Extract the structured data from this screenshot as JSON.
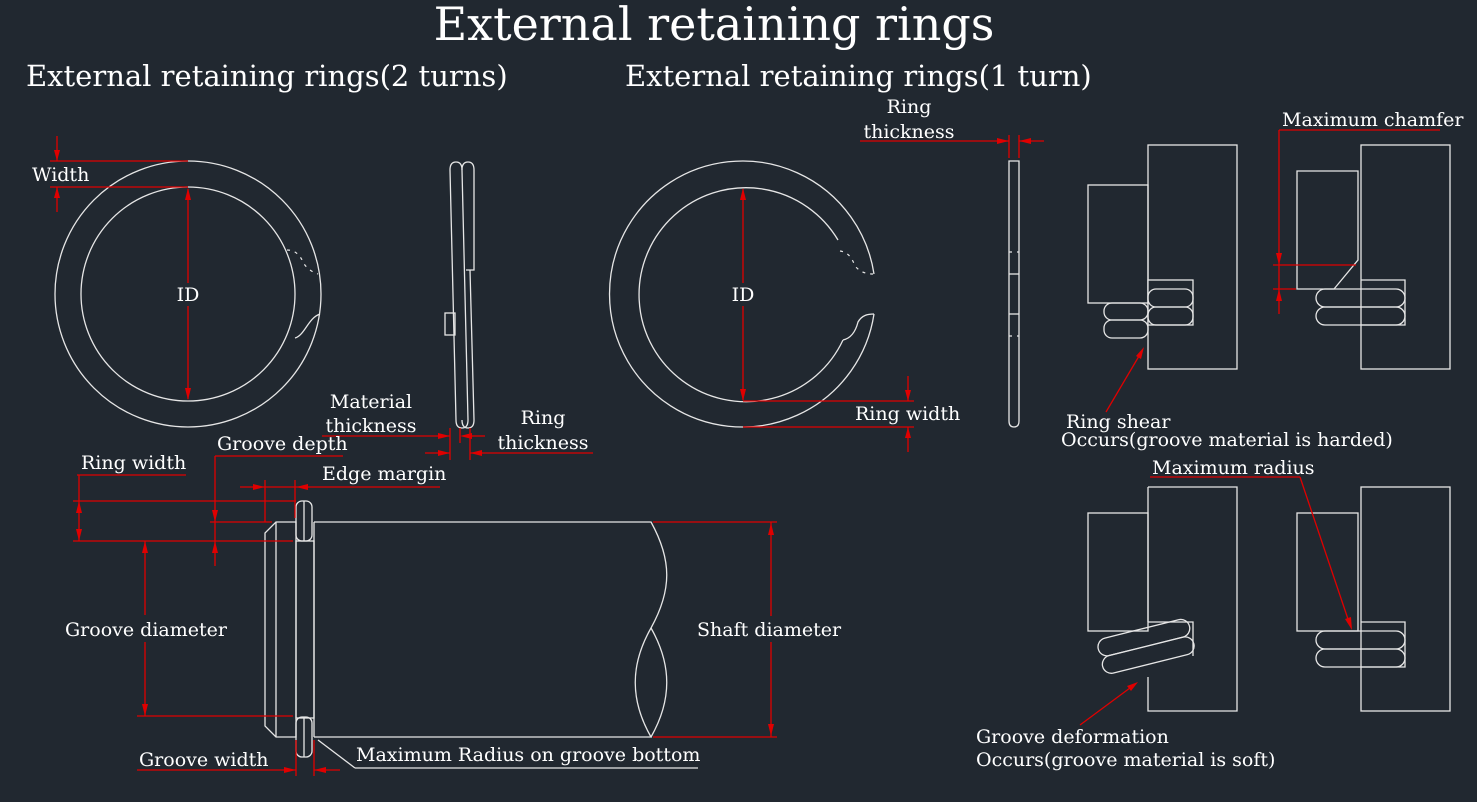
{
  "title": "External retaining rings",
  "sections": {
    "two_turns": "External retaining rings(2 turns)",
    "one_turn": "External retaining rings(1 turn)"
  },
  "labels": {
    "width": "Width",
    "id_2turn": "ID",
    "id_1turn": "ID",
    "material_thickness_1": "Material",
    "material_thickness_2": "thickness",
    "ring_thickness_2turn_1": "Ring",
    "ring_thickness_2turn_2": "thickness",
    "ring_thickness_1turn_1": "Ring",
    "ring_thickness_1turn_2": "thickness",
    "ring_width_1turn": "Ring width",
    "ring_width_shaft": "Ring width",
    "groove_depth": "Groove depth",
    "edge_margin": "Edge margin",
    "groove_diameter": "Groove diameter",
    "shaft_diameter": "Shaft diameter",
    "groove_width": "Groove width",
    "max_radius_groove_bottom": "Maximum Radius on groove bottom",
    "maximum_chamfer": "Maximum chamfer",
    "maximum_radius": "Maximum radius",
    "ring_shear_1": "Ring shear",
    "ring_shear_2": "Occurs(groove material is harded)",
    "groove_deformation_1": "Groove deformation",
    "groove_deformation_2": "Occurs(groove material is soft)"
  },
  "colors": {
    "background": "#212830",
    "line": "#e6e6e6",
    "dimension": "#e00000",
    "text": "#ffffff"
  }
}
